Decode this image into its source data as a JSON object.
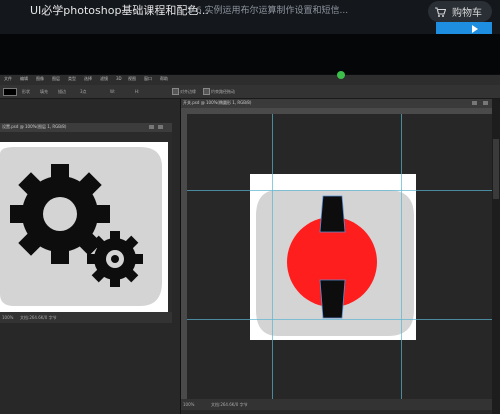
{
  "video": {
    "course_title": "UI必学photoshop基础课程和配色...",
    "episode_title": "2-6 实例运用布尔运算制作设置和短信...",
    "cart_label": "购物车"
  },
  "photoshop": {
    "menus": [
      "文件",
      "编辑",
      "图像",
      "图层",
      "类型",
      "选择",
      "滤镜",
      "3D",
      "视图",
      "窗口",
      "帮助"
    ],
    "options": {
      "mode": "形状",
      "fill_label": "填充",
      "stroke_label": "描边",
      "stroke_size": "3点",
      "w_label": "W:",
      "h_label": "H:",
      "align_edges": "对齐边缘",
      "constrain": "约束路径拖动"
    },
    "left_doc": {
      "tab": "设置.psd @ 100%(图层 1, RGB/8)",
      "zoom": "100%",
      "status": "文档:264.6K/0 字节"
    },
    "right_doc": {
      "tab": "开关.psd @ 100%(椭圆形 1, RGB/8)",
      "zoom": "100%",
      "status": "文档:264.6K/0 字节"
    }
  },
  "colors": {
    "accent_blue": "#1e8fe0",
    "icon_bg": "#d4d4d4",
    "gear": "#0d0d0d",
    "power_red": "#ff1e1e"
  },
  "icons": [
    "cart-icon",
    "gear-icon",
    "power-switch-icon"
  ]
}
